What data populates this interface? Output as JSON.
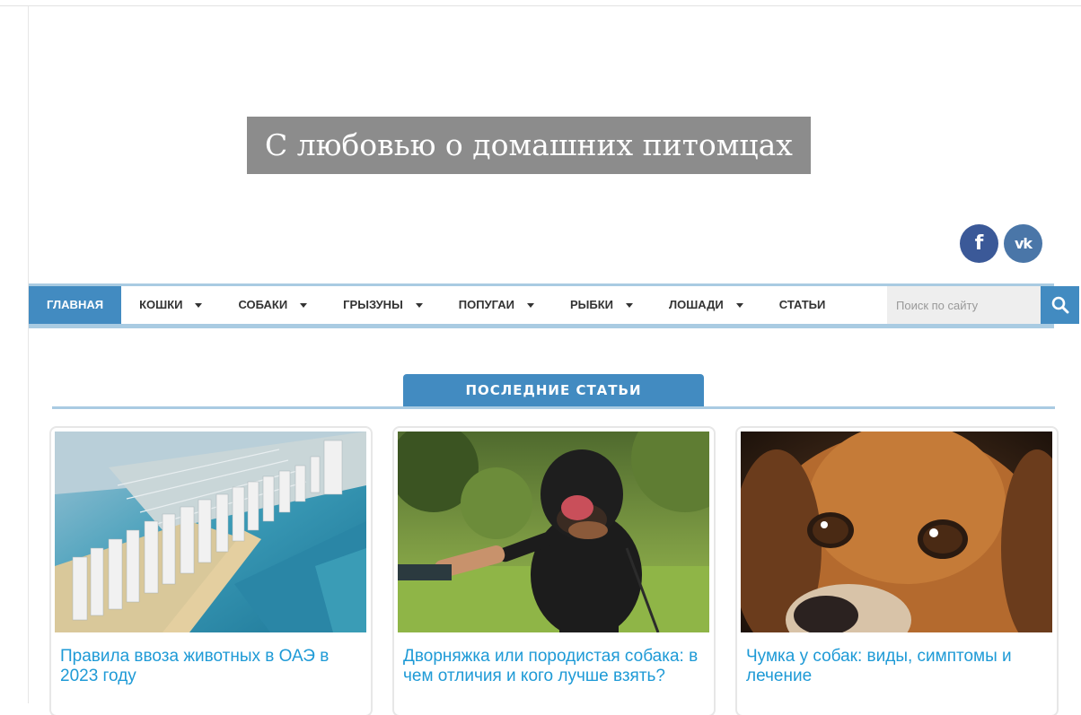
{
  "site": {
    "title": "С любовью о домашних питомцах",
    "social": {
      "facebook_icon": "f",
      "vk_icon": "vk"
    }
  },
  "nav": {
    "items": [
      {
        "label": "ГЛАВНАЯ",
        "active": true,
        "dropdown": false
      },
      {
        "label": "КОШКИ",
        "active": false,
        "dropdown": true
      },
      {
        "label": "СОБАКИ",
        "active": false,
        "dropdown": true
      },
      {
        "label": "ГРЫЗУНЫ",
        "active": false,
        "dropdown": true
      },
      {
        "label": "ПОПУГАИ",
        "active": false,
        "dropdown": true
      },
      {
        "label": "РЫБКИ",
        "active": false,
        "dropdown": true
      },
      {
        "label": "ЛОШАДИ",
        "active": false,
        "dropdown": true
      },
      {
        "label": "СТАТЬИ",
        "active": false,
        "dropdown": false
      }
    ],
    "search_placeholder": "Поиск по сайту",
    "search_icon": "search-icon"
  },
  "latest": {
    "heading": "ПОСЛЕДНИЕ СТАТЬИ",
    "cards": [
      {
        "title": "Правила ввоза животных в ОАЭ в 2023 году",
        "image": "dubai-harbor-aerial"
      },
      {
        "title": "Дворняжка или породистая собака: в чем отличия и кого лучше взять?",
        "image": "black-dog-paw-handshake"
      },
      {
        "title": "Чумка у собак: виды, симптомы и лечение",
        "image": "sad-beagle-closeup"
      }
    ]
  },
  "colors": {
    "accent": "#428bc1",
    "accent_light": "#a9cbe2",
    "title_bg": "#8c8c8c",
    "link": "#1e9ad6",
    "facebook": "#3b5998",
    "vk": "#4a76a8"
  }
}
